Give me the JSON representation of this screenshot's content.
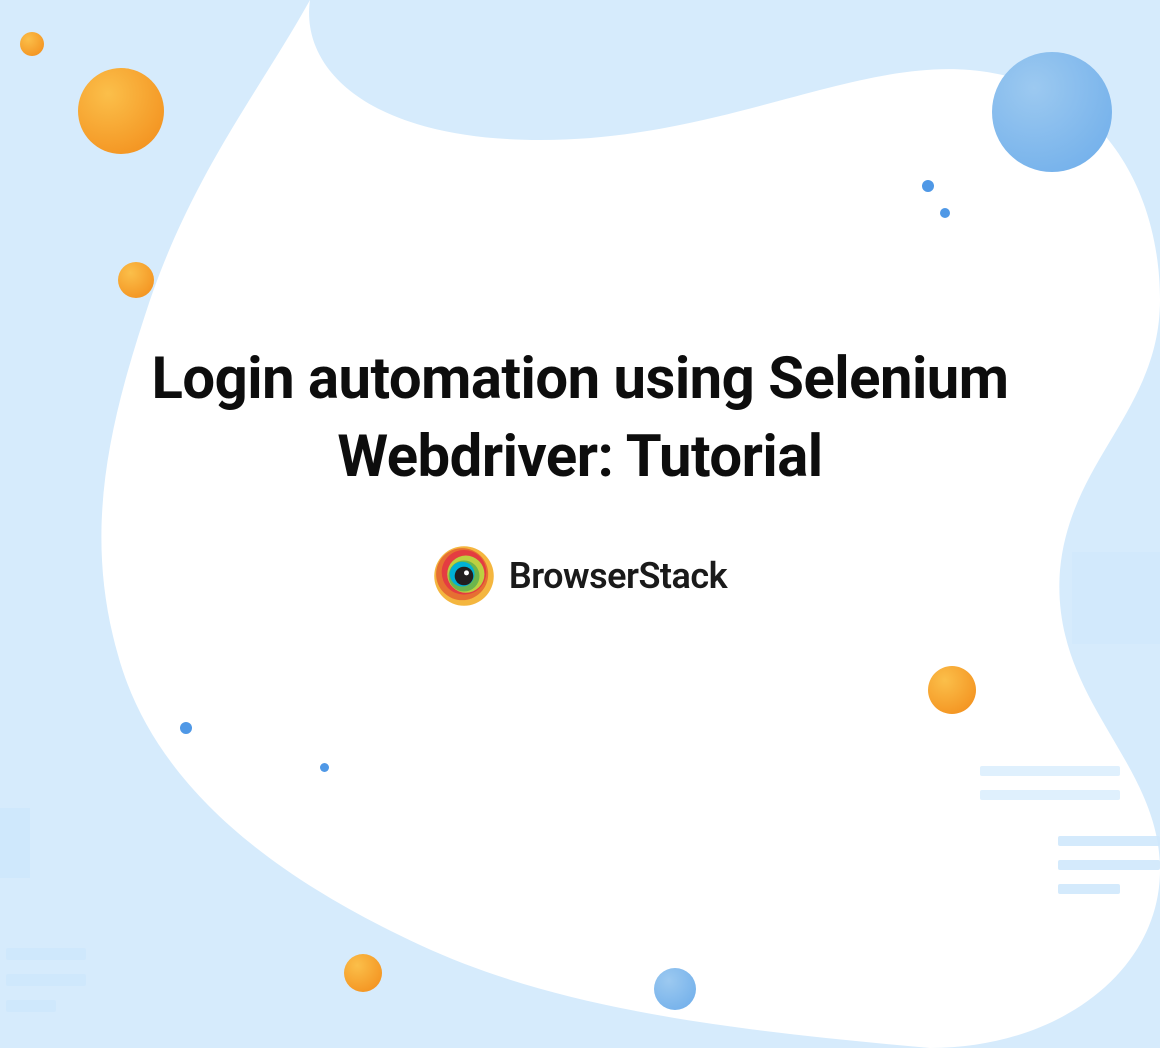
{
  "title": "Login automation using Selenium Webdriver: Tutorial",
  "brand_name": "BrowserStack",
  "colors": {
    "bg_blue": "#d6ebfc",
    "orange_light": "#f9a826",
    "orange_dark": "#f28c18",
    "dot_blue": "#3b82f6",
    "dot_lightblue": "#7fb9e8"
  }
}
